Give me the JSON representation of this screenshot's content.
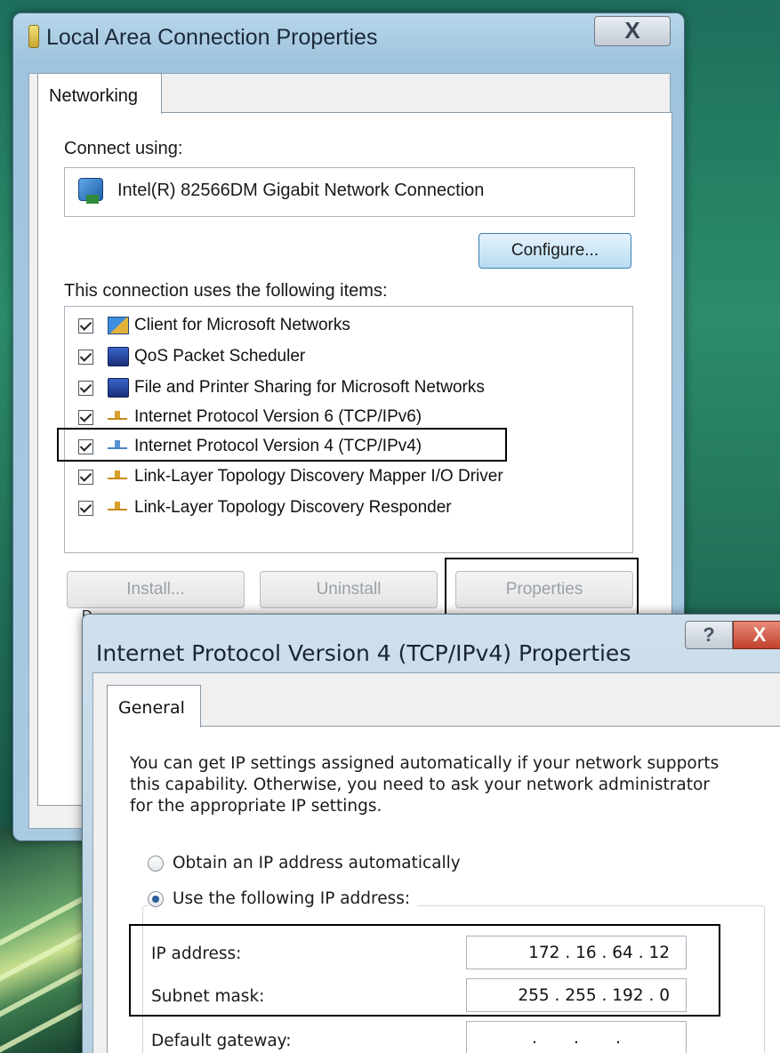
{
  "window1": {
    "title": "Local Area Connection Properties",
    "close_label": "X",
    "tab": "Networking",
    "connect_using_label": "Connect using:",
    "adapter_name": "Intel(R) 82566DM Gigabit Network Connection",
    "configure_label": "Configure...",
    "items_label": "This connection uses the following items:",
    "items": [
      {
        "label": "Client for Microsoft Networks",
        "checked": true,
        "icon": "network-client-icon"
      },
      {
        "label": "QoS Packet Scheduler",
        "checked": true,
        "icon": "computer-icon"
      },
      {
        "label": "File and Printer Sharing for Microsoft Networks",
        "checked": true,
        "icon": "computer-icon"
      },
      {
        "label": "Internet Protocol Version 6 (TCP/IPv6)",
        "checked": true,
        "icon": "protocol-icon"
      },
      {
        "label": "Internet Protocol Version 4 (TCP/IPv4)",
        "checked": true,
        "icon": "protocol-icon"
      },
      {
        "label": "Link-Layer Topology Discovery Mapper I/O Driver",
        "checked": true,
        "icon": "protocol-icon"
      },
      {
        "label": "Link-Layer Topology Discovery Responder",
        "checked": true,
        "icon": "protocol-icon"
      }
    ],
    "install_label": "Install...",
    "uninstall_label": "Uninstall",
    "properties_label": "Properties",
    "description_partial": "D"
  },
  "window2": {
    "title": "Internet Protocol Version 4 (TCP/IPv4) Properties",
    "help_label": "?",
    "close_label": "X",
    "tab": "General",
    "description_line1": "You can get IP settings assigned automatically if your network supports",
    "description_line2": "this capability. Otherwise, you need to ask your network administrator",
    "description_line3": "for the appropriate IP settings.",
    "radio_auto": "Obtain an IP address automatically",
    "radio_manual": "Use the following IP address:",
    "selected_radio": "manual",
    "ip_label": "IP address:",
    "ip_value": "172 . 16 . 64 . 12",
    "subnet_label": "Subnet mask:",
    "subnet_value": "255 . 255 . 192 . 0",
    "gateway_label": "Default gateway:",
    "gateway_value": ".       .       ."
  }
}
